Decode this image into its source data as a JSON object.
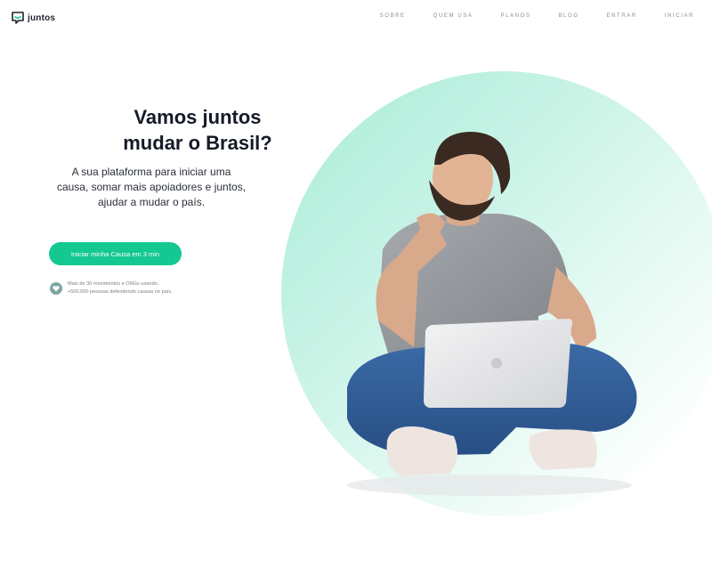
{
  "brand": {
    "name": "juntos",
    "accent": "#14c892"
  },
  "nav": {
    "items": [
      {
        "label": "SOBRE"
      },
      {
        "label": "QUEM USA"
      },
      {
        "label": "PLANOS"
      },
      {
        "label": "BLOG"
      },
      {
        "label": "ENTRAR"
      },
      {
        "label": "INICIAR"
      }
    ]
  },
  "hero": {
    "title_line1": "Vamos juntos",
    "title_line2": "mudar o Brasil?",
    "subtitle_line1": "A sua plataforma para iniciar uma",
    "subtitle_line2": "causa, somar mais apoiadores e juntos,",
    "subtitle_line3": "ajudar a mudar o país.",
    "cta_label": "Iniciar minha Causa em 3 min",
    "stats_line1": "Mais de 30 movimentos e ONGs usando,",
    "stats_line2": "+500.000 pessoas defendendo causas no país."
  }
}
